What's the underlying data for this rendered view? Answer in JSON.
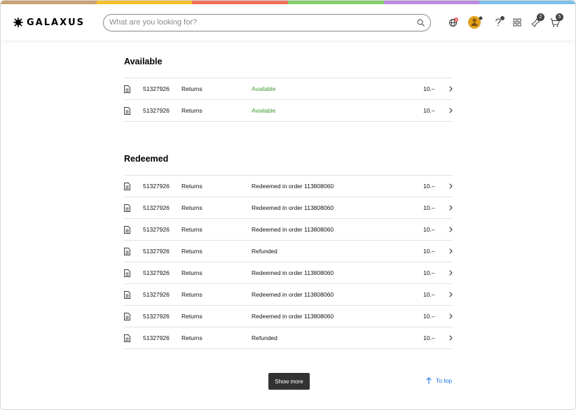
{
  "rainbow_colors": [
    "#c9a274",
    "#f6bf2b",
    "#f0715a",
    "#86cf6b",
    "#b88be0",
    "#7cc1ec"
  ],
  "header": {
    "logo_text": "GALAXUS",
    "search_placeholder": "What are you looking for?",
    "icons": [
      "search-icon",
      "language-icon",
      "avatar",
      "help-icon",
      "compare-icon",
      "watchlist-icon",
      "cart-icon"
    ],
    "watchlist_count": "2",
    "cart_count": "5"
  },
  "sections": {
    "available": {
      "title": "Available",
      "rows": [
        {
          "number": "51327926",
          "type": "Returns",
          "status": "Available",
          "amount": "10.–"
        },
        {
          "number": "51327926",
          "type": "Returns",
          "status": "Available",
          "amount": "10.–"
        }
      ]
    },
    "redeemed": {
      "title": "Redeemed",
      "rows": [
        {
          "number": "51327926",
          "type": "Returns",
          "status": "Redeemed in order 113808060",
          "amount": "10.–"
        },
        {
          "number": "51327926",
          "type": "Returns",
          "status": "Redeemed in order 113808060",
          "amount": "10.–"
        },
        {
          "number": "51327926",
          "type": "Returns",
          "status": "Redeemed in order 113808060",
          "amount": "10.–"
        },
        {
          "number": "51327926",
          "type": "Returns",
          "status": "Refunded",
          "amount": "10.–"
        },
        {
          "number": "51327926",
          "type": "Returns",
          "status": "Redeemed in order 113808060",
          "amount": "10.–"
        },
        {
          "number": "51327926",
          "type": "Returns",
          "status": "Redeemed in order 113808060",
          "amount": "10.–"
        },
        {
          "number": "51327926",
          "type": "Returns",
          "status": "Redeemed in order 113808060",
          "amount": "10.–"
        },
        {
          "number": "51327926",
          "type": "Returns",
          "status": "Refunded",
          "amount": "10.–"
        }
      ]
    }
  },
  "footer": {
    "show_more_label": "Show more",
    "to_top_label": "To top"
  },
  "colors": {
    "available_status": "#3f9b2c",
    "link": "#1a73e8",
    "button_bg": "#333333"
  }
}
